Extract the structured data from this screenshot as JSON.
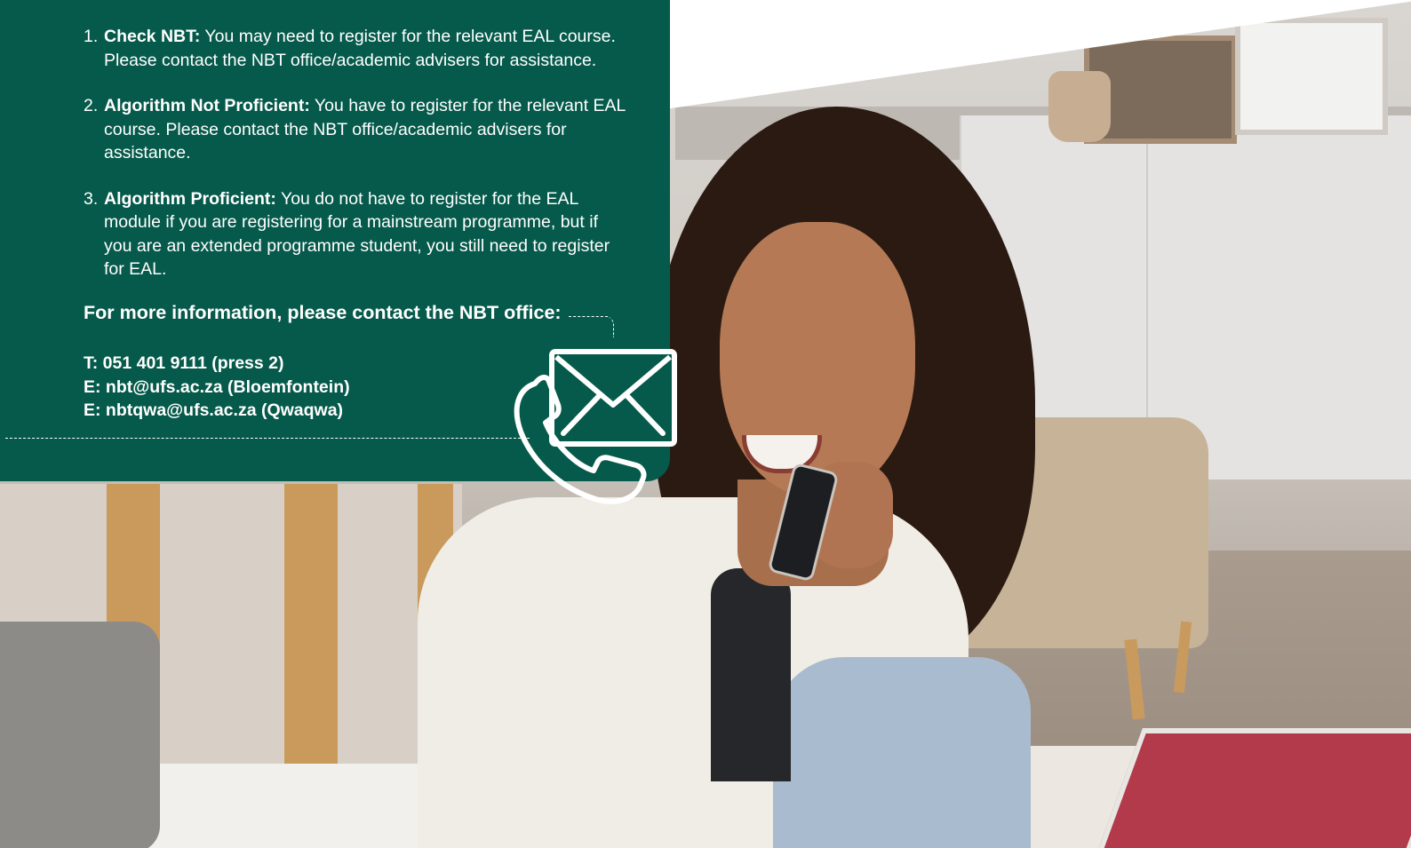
{
  "info_panel": {
    "steps": [
      {
        "number": "1.",
        "term": "Check NBT:",
        "text": " You may need to register for the relevant EAL course. Please contact the NBT office/academic advisers for assistance."
      },
      {
        "number": "2.",
        "term": "Algorithm Not Proficient:",
        "text": " You have to register for the relevant EAL course. Please contact the NBT office/academic advisers for assistance."
      },
      {
        "number": "3.",
        "term": "Algorithm Proficient:",
        "text": " You do not have to register for the EAL module if you are registering for a mainstream programme, but if you are an extended programme student, you still need to register for EAL."
      }
    ],
    "contact_heading": "For more information, please contact the NBT office:",
    "contacts": {
      "phone": "T: 051 401 9111 (press 2)",
      "email_bloemfontein": "E: nbt@ufs.ac.za (Bloemfontein)",
      "email_qwaqwa": "E: nbtqwa@ufs.ac.za (Qwaqwa)"
    },
    "icon": "phone-envelope-icon"
  },
  "colors": {
    "panel_green": "#065a4b",
    "text": "#ffffff"
  }
}
